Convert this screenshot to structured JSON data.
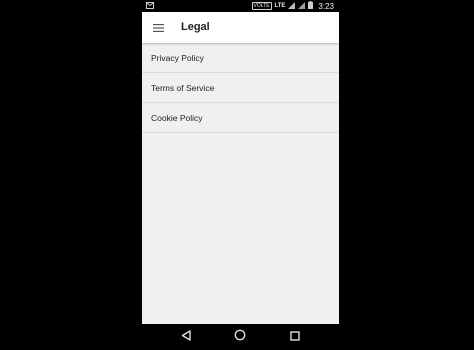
{
  "status_bar": {
    "volte_label": "VOLTE",
    "lte_label": "LTE",
    "time": "3:23"
  },
  "app_bar": {
    "title": "Legal"
  },
  "legal_list": {
    "items": [
      {
        "label": "Privacy Policy"
      },
      {
        "label": "Terms of Service"
      },
      {
        "label": "Cookie Policy"
      }
    ]
  },
  "icons": {
    "status_notification": "gmail-icon",
    "menu": "hamburger-menu-icon",
    "nav_back": "back-triangle-icon",
    "nav_home": "home-circle-icon",
    "nav_recents": "recents-square-icon"
  },
  "colors": {
    "app_bar_bg": "#ffffff",
    "content_bg": "#f0f0f0",
    "divider": "#dcdcdc",
    "text": "#222222",
    "system_bars": "#000000"
  }
}
